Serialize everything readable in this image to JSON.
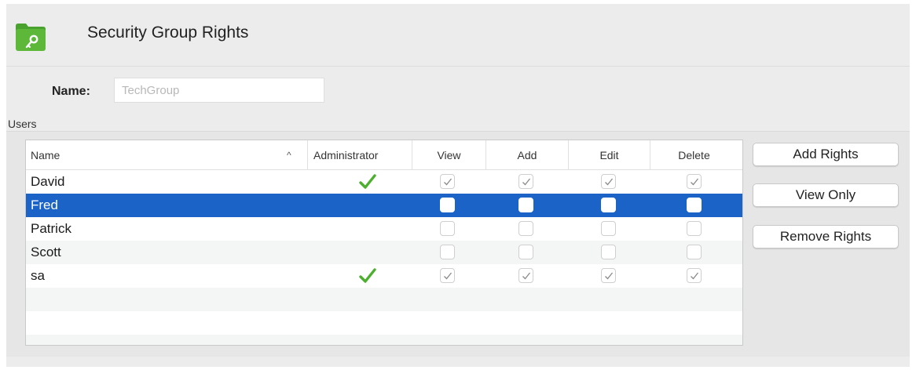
{
  "header": {
    "title": "Security Group Rights",
    "icon": "folder-key-icon",
    "icon_color": "#5db83a"
  },
  "form": {
    "name_label": "Name:",
    "name_value": "TechGroup"
  },
  "users": {
    "section_label": "Users",
    "columns": {
      "name": "Name",
      "administrator": "Administrator",
      "view": "View",
      "add": "Add",
      "edit": "Edit",
      "delete": "Delete"
    },
    "sort_indicator": "^",
    "rows": [
      {
        "name": "David",
        "administrator": true,
        "view": true,
        "add": true,
        "edit": true,
        "delete": true,
        "selected": false
      },
      {
        "name": "Fred",
        "administrator": false,
        "view": false,
        "add": false,
        "edit": false,
        "delete": false,
        "selected": true
      },
      {
        "name": "Patrick",
        "administrator": false,
        "view": false,
        "add": false,
        "edit": false,
        "delete": false,
        "selected": false
      },
      {
        "name": "Scott",
        "administrator": false,
        "view": false,
        "add": false,
        "edit": false,
        "delete": false,
        "selected": false
      },
      {
        "name": "sa",
        "administrator": true,
        "view": true,
        "add": true,
        "edit": true,
        "delete": true,
        "selected": false
      }
    ]
  },
  "actions": {
    "add_rights": "Add Rights",
    "view_only": "View Only",
    "remove_rights": "Remove Rights"
  },
  "colors": {
    "selection": "#1b63c6",
    "admin_check": "#4caf2d"
  }
}
